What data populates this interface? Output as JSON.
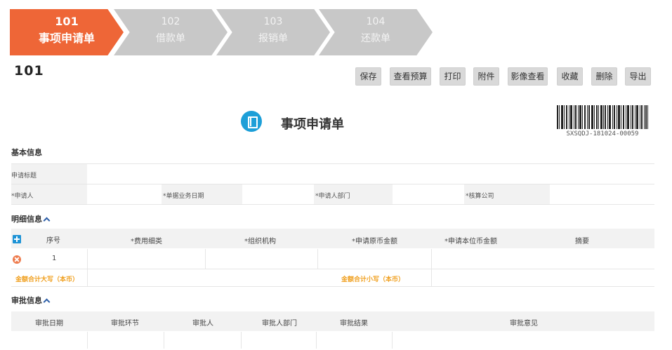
{
  "steps": [
    {
      "num": "101",
      "name": "事项申请单",
      "state": "active"
    },
    {
      "num": "102",
      "name": "借款单",
      "state": "inactive"
    },
    {
      "num": "103",
      "name": "报销单",
      "state": "inactive"
    },
    {
      "num": "104",
      "name": "还款单",
      "state": "inactive"
    }
  ],
  "doc_code": "101",
  "toolbar": {
    "save": "保存",
    "view_budget": "查看预算",
    "print": "打印",
    "attachment": "附件",
    "view_image": "影像查看",
    "favorite": "收藏",
    "delete": "删除",
    "export": "导出"
  },
  "form_title": "事项申请单",
  "barcode_text": "SXSQDJ-181024-00059",
  "basic": {
    "section": "基本信息",
    "apply_title_label": "申请标题",
    "applicant_label": "申请人",
    "biz_date_label": "单据业务日期",
    "dept_label": "申请人部门",
    "company_label": "核算公司"
  },
  "detail": {
    "section": "明细信息",
    "columns": {
      "seq": "序号",
      "expense_type": "费用细类",
      "org": "组织机构",
      "orig_amount": "申请原币金额",
      "local_amount": "申请本位币金额",
      "summary": "摘要"
    },
    "rows": [
      {
        "seq": "1"
      }
    ],
    "total_upper": "金额合计大写（本币）",
    "total_lower": "金额合计小写（本币）"
  },
  "approval": {
    "section": "审批信息",
    "columns": {
      "date": "审批日期",
      "step": "审批环节",
      "approver": "审批人",
      "dept": "审批人部门",
      "result": "审批结果",
      "opinion": "审批意见"
    }
  },
  "colors": {
    "accent": "#ee6637",
    "inactive_step": "#c8c8c8",
    "icon_blue": "#1d9fd8",
    "total_orange": "#f0a020"
  }
}
